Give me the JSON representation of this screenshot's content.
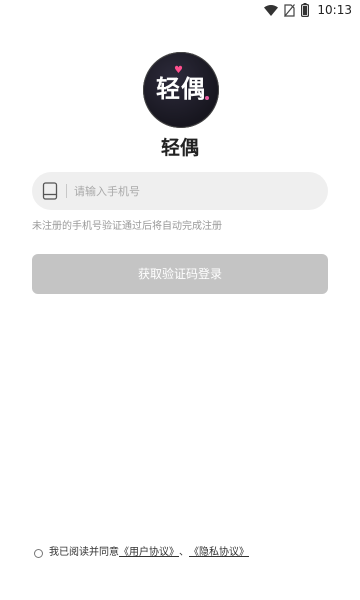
{
  "status_bar": {
    "time": "10:13",
    "icons": [
      "wifi-icon",
      "no-sim-icon",
      "battery-icon"
    ]
  },
  "app": {
    "logo_text": "轻偶",
    "name": "轻偶"
  },
  "phone": {
    "placeholder": "请输入手机号",
    "value": "",
    "icon": "phone-icon"
  },
  "hint": "未注册的手机号验证通过后将自动完成注册",
  "login_button": "获取验证码登录",
  "agreement": {
    "prefix": "我已阅读并同意",
    "user_agreement": "《用户协议》",
    "separator": "、",
    "privacy_agreement": "《隐私协议》",
    "checked": false
  },
  "colors": {
    "background": "#ffffff",
    "input_bg": "#efefef",
    "button_disabled": "#c4c4c4",
    "hint_text": "#9a9a9a",
    "logo_bg": "#1b1a24",
    "logo_heart": "#ff4f8e"
  }
}
